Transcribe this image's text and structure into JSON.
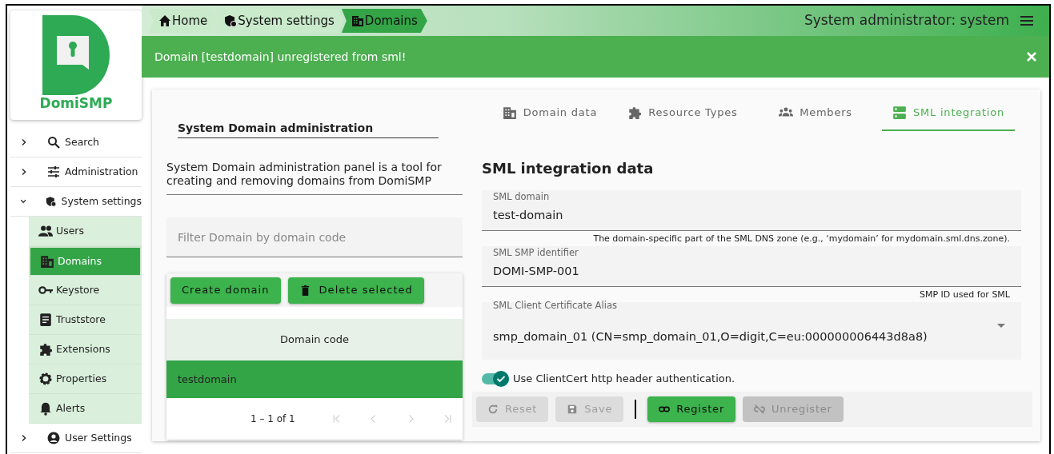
{
  "logo": {
    "text": "DomiSMP"
  },
  "breadcrumb": [
    {
      "label": "Home",
      "selected": false
    },
    {
      "label": "System settings",
      "selected": false
    },
    {
      "label": "Domains",
      "selected": true
    }
  ],
  "user": {
    "label": "System administrator: system"
  },
  "alert": {
    "message": "Domain [testdomain] unregistered from sml!"
  },
  "sidebar": {
    "items": [
      {
        "label": "Search",
        "expanded": false
      },
      {
        "label": "Administration",
        "expanded": false
      },
      {
        "label": "System settings",
        "expanded": true,
        "children": [
          {
            "label": "Users",
            "selected": false
          },
          {
            "label": "Domains",
            "selected": true
          },
          {
            "label": "Keystore",
            "selected": false
          },
          {
            "label": "Truststore",
            "selected": false
          },
          {
            "label": "Extensions",
            "selected": false
          },
          {
            "label": "Properties",
            "selected": false
          },
          {
            "label": "Alerts",
            "selected": false
          }
        ]
      },
      {
        "label": "User Settings",
        "expanded": false
      }
    ]
  },
  "panel": {
    "title": "System Domain administration",
    "description": "System Domain administration panel is a tool for creating and removing domains from DomiSMP",
    "filter": {
      "placeholder": "Filter Domain by domain code"
    },
    "buttons": [
      "Create domain",
      "Delete selected"
    ],
    "table": {
      "columns": [
        "Domain code"
      ],
      "rows": [
        {
          "cells": [
            "testdomain"
          ],
          "selected": true
        }
      ]
    },
    "paginator": {
      "range": "1 – 1 of 1",
      "nav": [
        {
          "disabled": true
        },
        {
          "disabled": true
        },
        {
          "disabled": true
        },
        {
          "disabled": true
        }
      ]
    }
  },
  "tabs": [
    {
      "label": "Domain data",
      "selected": false
    },
    {
      "label": "Resource Types",
      "selected": false
    },
    {
      "label": "Members",
      "selected": false
    },
    {
      "label": "SML integration",
      "selected": true
    }
  ],
  "form": {
    "heading": "SML integration data",
    "fields": [
      {
        "kind": "text",
        "label": "SML domain",
        "value": "test-domain",
        "hint": "The domain-specific part of the SML DNS zone (e.g., ‘mydomain’ for mydomain.sml.dns.zone)."
      },
      {
        "kind": "text",
        "label": "SML SMP identifier",
        "value": "DOMI-SMP-001",
        "hint": "SMP ID used for SML"
      },
      {
        "kind": "select",
        "label": "SML Client Certificate Alias",
        "value": "smp_domain_01 (CN=smp_domain_01,O=digit,C=eu:000000006443d8a8)"
      }
    ],
    "toggle": {
      "label": "Use ClientCert http header authentication.",
      "on": true
    },
    "actions": [
      {
        "label": "Reset",
        "disabled": true
      },
      {
        "label": "Save",
        "disabled": true
      },
      {
        "label": "Register",
        "disabled": false
      },
      {
        "label": "Unregister",
        "disabled": true
      }
    ]
  }
}
